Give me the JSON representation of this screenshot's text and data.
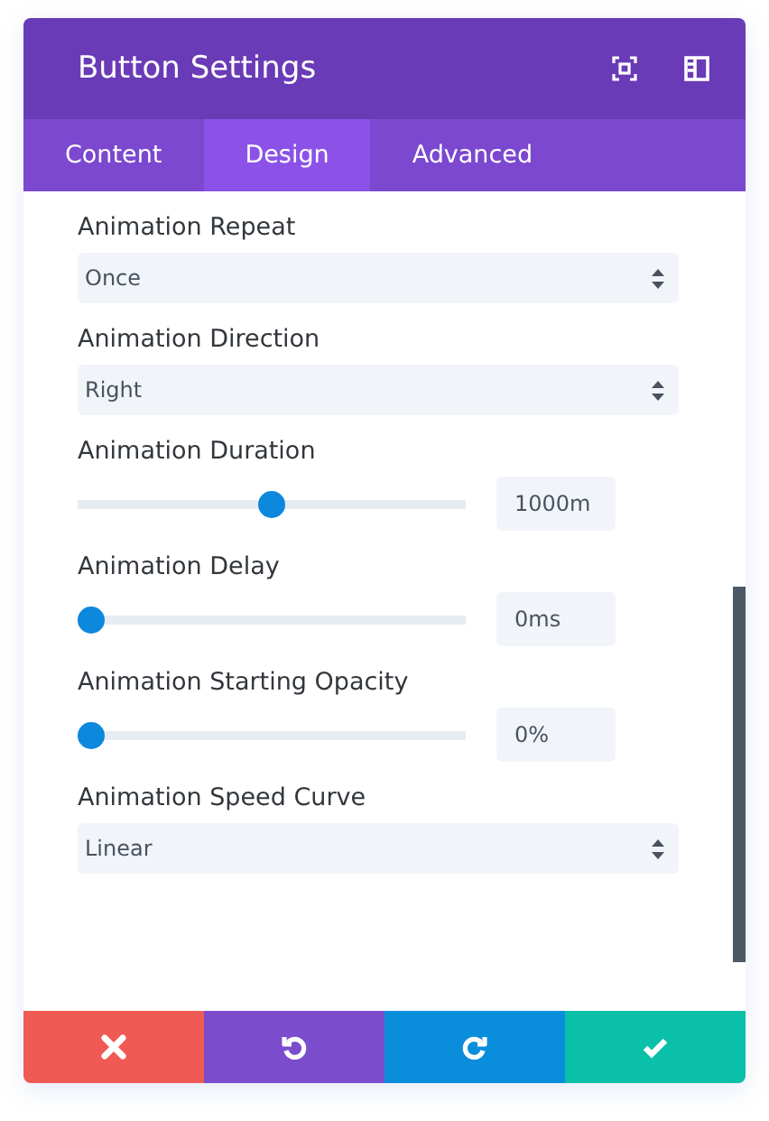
{
  "window": {
    "title": "Button Settings"
  },
  "tabs": [
    {
      "label": "Content",
      "selected": false
    },
    {
      "label": "Design",
      "selected": true
    },
    {
      "label": "Advanced",
      "selected": false
    }
  ],
  "settings": [
    {
      "kind": "select",
      "label": "Animation Repeat",
      "value": "Once"
    },
    {
      "kind": "select",
      "label": "Animation Direction",
      "value": "Right"
    },
    {
      "kind": "slider",
      "label": "Animation Duration",
      "level": 0.5,
      "value": "1000m"
    },
    {
      "kind": "slider",
      "label": "Animation Delay",
      "level": 0,
      "value": "0ms"
    },
    {
      "kind": "slider",
      "label": "Animation Starting Opacity",
      "level": 0,
      "value": "0%"
    },
    {
      "kind": "select",
      "label": "Animation Speed Curve",
      "value": "Linear"
    }
  ],
  "footer_buttons": [
    {
      "kind": "cancel"
    },
    {
      "kind": "undo"
    },
    {
      "kind": "redo"
    },
    {
      "kind": "save"
    }
  ]
}
